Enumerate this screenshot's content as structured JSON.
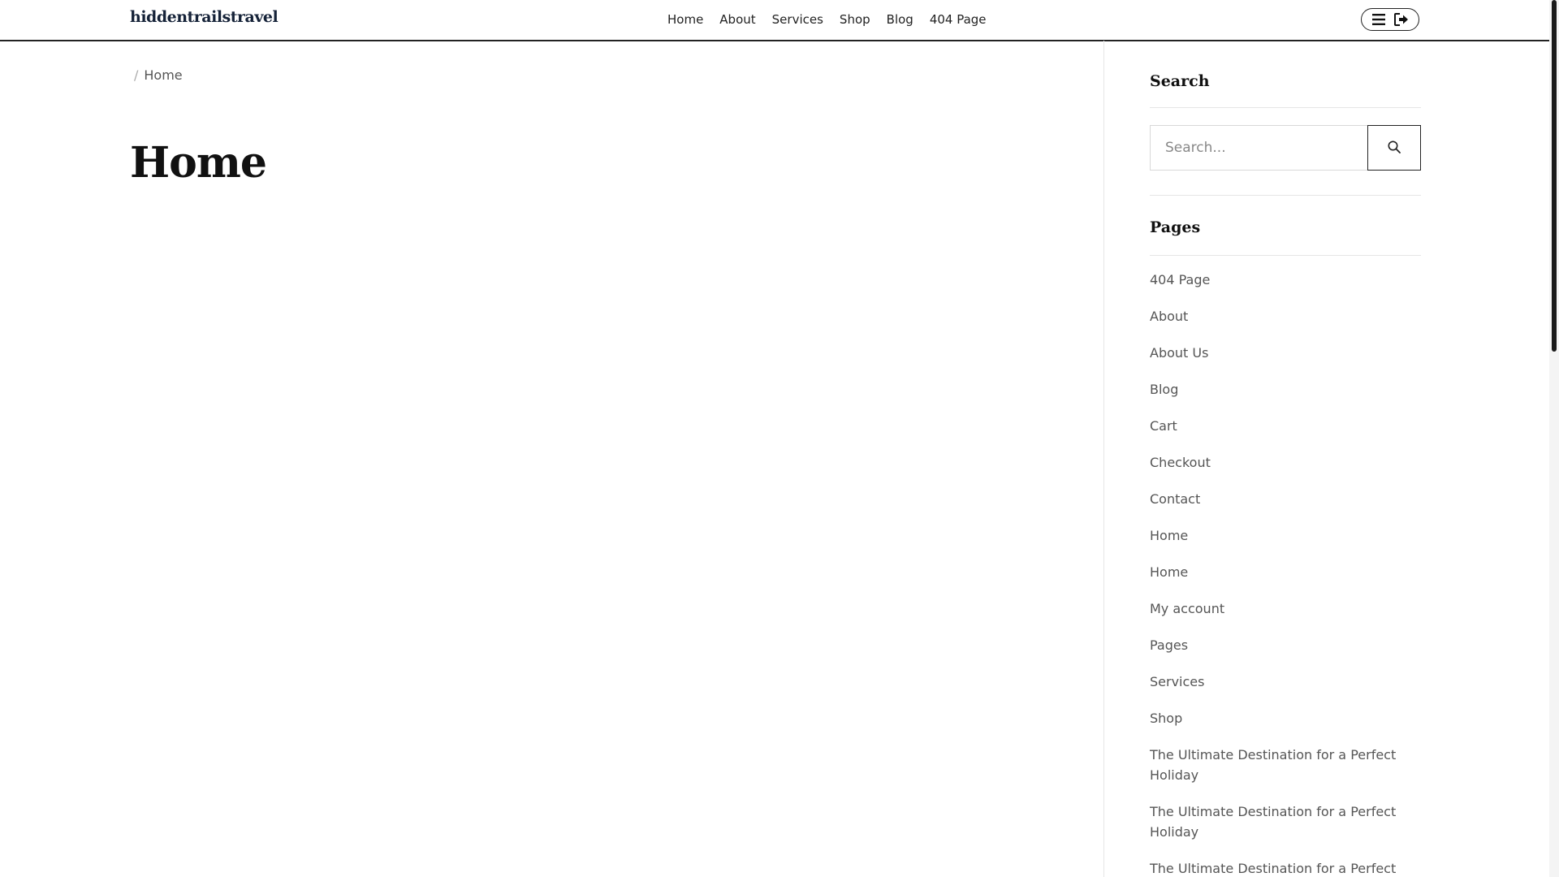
{
  "site": {
    "logo": "hiddentrailstravel"
  },
  "nav": {
    "items": [
      {
        "label": "Home"
      },
      {
        "label": "About"
      },
      {
        "label": "Services"
      },
      {
        "label": "Shop"
      },
      {
        "label": "Blog"
      },
      {
        "label": "404 Page"
      }
    ]
  },
  "header_icons": {
    "menu": "menu-icon",
    "login": "sign-in-icon"
  },
  "breadcrumb": {
    "separator": "/",
    "current": "Home"
  },
  "page": {
    "title": "Home"
  },
  "sidebar": {
    "search": {
      "title": "Search",
      "placeholder": "Search...",
      "button_icon": "search-icon"
    },
    "pages": {
      "title": "Pages",
      "items": [
        "404 Page",
        "About",
        "About Us",
        "Blog",
        "Cart",
        "Checkout",
        "Contact",
        "Home",
        "Home",
        "My account",
        "Pages",
        "Services",
        "Shop",
        "The Ultimate Destination for a Perfect Holiday",
        "The Ultimate Destination for a Perfect Holiday",
        "The Ultimate Destination for a Perfect Holiday"
      ]
    }
  },
  "colors": {
    "text": "#333333",
    "heading": "#111111",
    "logo": "#152238",
    "border": "#222222",
    "muted_border": "#e5e5e5"
  }
}
